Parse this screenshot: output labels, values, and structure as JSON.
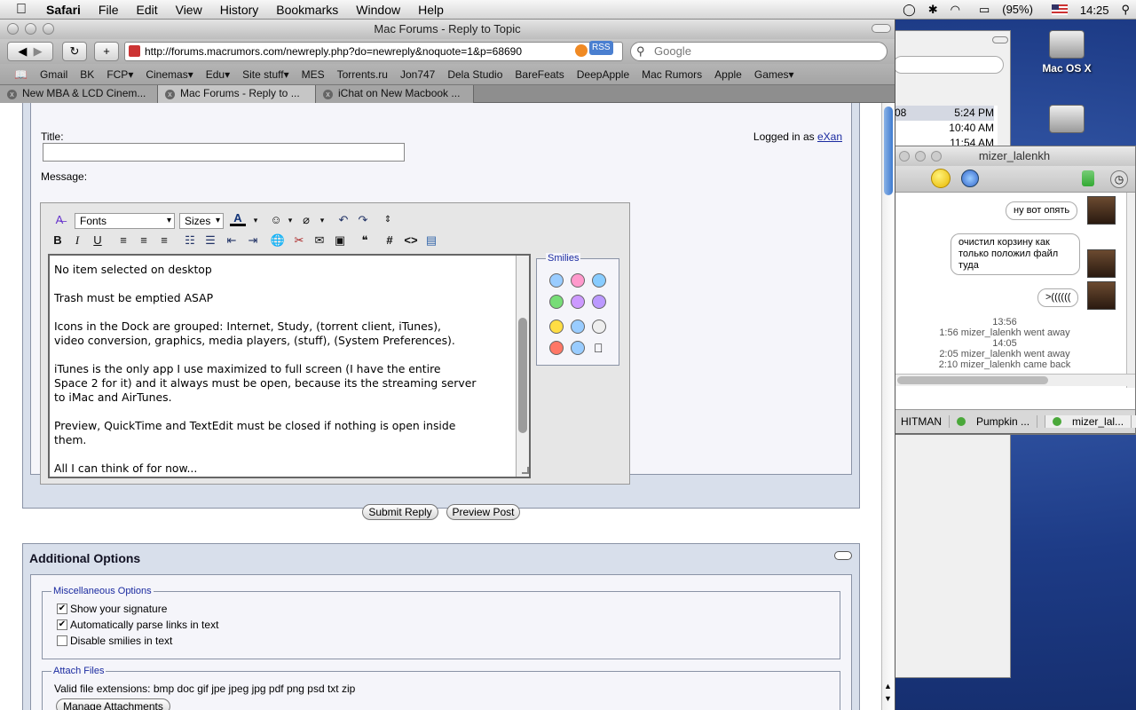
{
  "menubar": {
    "app": "Safari",
    "items": [
      "File",
      "Edit",
      "View",
      "History",
      "Bookmarks",
      "Window",
      "Help"
    ],
    "battery": "(95%)",
    "clock": "14:25"
  },
  "desktop": {
    "disk_label": "Mac OS X"
  },
  "safari": {
    "title": "Mac Forums - Reply to Topic",
    "url": "http://forums.macrumors.com/newreply.php?do=newreply&noquote=1&p=68690",
    "rss": "RSS",
    "search_placeholder": "Google",
    "bookmarks": [
      "Gmail",
      "BK",
      "FCP▾",
      "Cinemas▾",
      "Edu▾",
      "Site stuff▾",
      "MES",
      "Torrents.ru",
      "Jon747",
      "Dela Studio",
      "BareFeats",
      "DeepApple",
      "Mac Rumors",
      "Apple",
      "Games▾"
    ],
    "tabs": [
      "New MBA & LCD Cinem...",
      "Mac Forums - Reply to ...",
      "iChat on New Macbook ..."
    ]
  },
  "form": {
    "title_label": "Title:",
    "logged_in": "Logged in as",
    "username": "eXan",
    "message_label": "Message:",
    "fonts": "Fonts",
    "sizes": "Sizes",
    "message_paragraphs": [
      "No item selected on desktop",
      "Trash must be emptied ASAP",
      "Icons in the Dock are grouped: Internet, Study, (torrent client, iTunes),\nvideo conversion, graphics, media players, (stuff), (System Preferences).",
      "iTunes is the only app I use maximized to full screen (I have the entire\nSpace 2 for it) and it always must be open, because its the streaming server\nto iMac and AirTunes.",
      "Preview, QuickTime and TextEdit must be closed if nothing is open inside\nthem.",
      "All I can think of for now..."
    ],
    "smilies_legend": "Smilies",
    "submit": "Submit Reply",
    "preview": "Preview Post"
  },
  "options": {
    "heading": "Additional Options",
    "misc_legend": "Miscellaneous Options",
    "checkboxes": [
      {
        "label": "Show your signature",
        "checked": true
      },
      {
        "label": "Automatically parse links in text",
        "checked": true
      },
      {
        "label": "Disable smilies in text",
        "checked": false
      }
    ],
    "attach_legend": "Attach Files",
    "extensions": "Valid file extensions: bmp doc gif jpe jpeg jpg pdf png psd txt zip",
    "manage": "Manage Attachments"
  },
  "background_list": {
    "times": [
      "5:24 PM",
      "10:40 AM",
      "11:54 AM"
    ],
    "partial": "08"
  },
  "ichat": {
    "title": "mizer_lalenkh",
    "messages": [
      "ну вот опять",
      "очистил корзину как только положил файл туда",
      ">(((((("
    ],
    "status": [
      "13:56",
      "1:56 mizer_lalenkh went away",
      "14:05",
      "2:05 mizer_lalenkh went away",
      "2:10 mizer_lalenkh came back"
    ],
    "tabs": [
      "HITMAN",
      "Pumpkin ...",
      "mizer_lal..."
    ]
  }
}
